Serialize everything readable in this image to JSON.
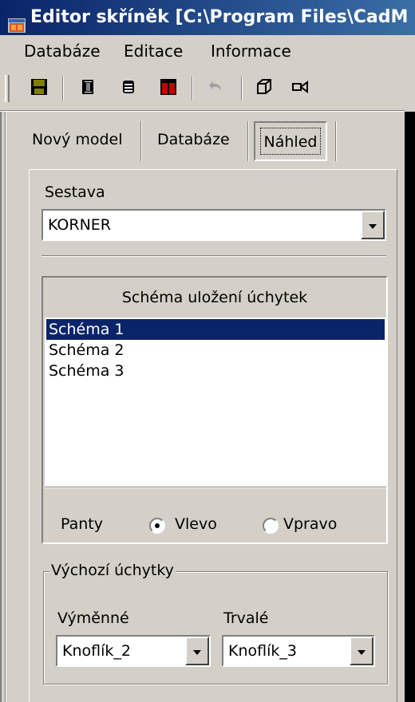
{
  "window": {
    "title": "Editor skříněk [C:\\Program Files\\CadM"
  },
  "menu": {
    "items": [
      {
        "label": "Databáze"
      },
      {
        "label": "Editace"
      },
      {
        "label": "Informace"
      }
    ]
  },
  "tabs": [
    {
      "label": "Nový model"
    },
    {
      "label": "Databáze"
    },
    {
      "label": "Náhled",
      "active": true
    }
  ],
  "sestava": {
    "label": "Sestava",
    "value": "KORNER"
  },
  "schema": {
    "header": "Schéma uložení úchytek",
    "items": [
      "Schéma 1",
      "Schéma 2",
      "Schéma 3"
    ],
    "selected_index": 0
  },
  "panty": {
    "label": "Panty",
    "options": [
      "Vlevo",
      "Vpravo"
    ],
    "selected": "Vlevo"
  },
  "vychozi": {
    "legend": "Výchozí úchytky",
    "vymenne": {
      "label": "Výměnné",
      "value": "Knoflík_2"
    },
    "trvale": {
      "label": "Trvalé",
      "value": "Knoflík_3"
    }
  },
  "colors": {
    "title_start": "#0a246a",
    "title_end": "#3a6ea5",
    "selection": "#0a246a",
    "face": "#d4d0c8"
  }
}
